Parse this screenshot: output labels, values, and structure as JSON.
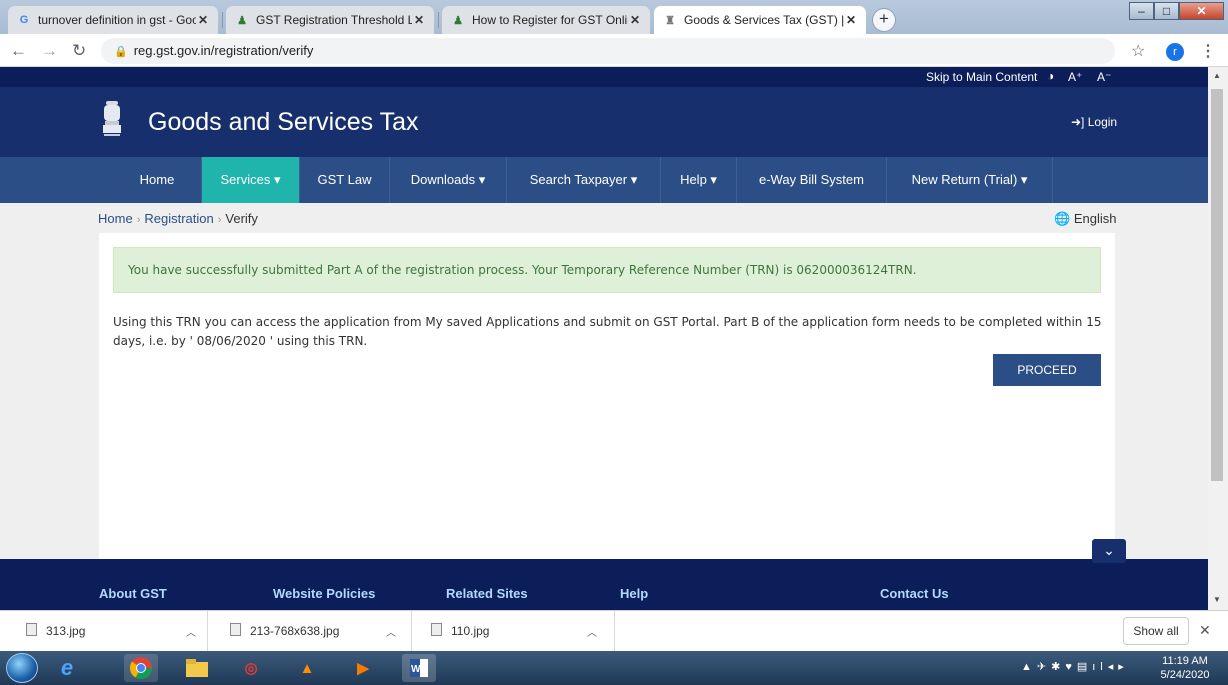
{
  "browser": {
    "tabs": [
      {
        "title": "turnover definition in gst - Goog",
        "icon": "google-icon"
      },
      {
        "title": "GST Registration Threshold Limit",
        "icon": "gst-icon"
      },
      {
        "title": "How to Register for GST Online -",
        "icon": "gst-icon"
      },
      {
        "title": "Goods & Services Tax (GST) | Reg",
        "icon": "emblem-icon"
      }
    ],
    "close_glyph": "✕",
    "new_tab": "+",
    "url": "reg.gst.gov.in/registration/verify",
    "profile_initial": "r"
  },
  "site": {
    "skip_link": "Skip to Main Content",
    "font_increase": "A⁺",
    "font_decrease": "A⁻",
    "title": "Goods and Services Tax",
    "login": "Login",
    "menu": [
      {
        "label": "Home"
      },
      {
        "label": "Services ▾"
      },
      {
        "label": "GST Law"
      },
      {
        "label": "Downloads ▾"
      },
      {
        "label": "Search Taxpayer ▾"
      },
      {
        "label": "Help ▾"
      },
      {
        "label": "e-Way Bill System"
      },
      {
        "label": "New Return (Trial) ▾"
      }
    ],
    "active_menu": "Services",
    "breadcrumb": [
      "Home",
      "Registration",
      "Verify"
    ],
    "language": "English"
  },
  "main": {
    "success_message": "You have successfully submitted Part A of the registration process. Your Temporary Reference Number (TRN) is 062000036124TRN.",
    "info_text": "Using this TRN you can access the application from My saved Applications and submit on GST Portal. Part B of the application form needs to be completed within 15 days, i.e. by ' 08/06/2020 ' using this TRN.",
    "proceed_label": "PROCEED"
  },
  "footer": {
    "links": [
      "About GST",
      "Website Policies",
      "Related Sites",
      "Help",
      "Contact Us"
    ]
  },
  "downloads": {
    "items": [
      "313.jpg",
      "213-768x638.jpg",
      "110.jpg"
    ],
    "show_all": "Show all"
  },
  "taskbar": {
    "time": "11:19 AM",
    "date": "5/24/2020"
  },
  "colors": {
    "header_bg": "#17306d",
    "menu_bg": "#2c4e86",
    "active_menu_bg": "#1fb5ad",
    "success_bg": "#dff0d8",
    "footer_bg": "#0b1e59"
  }
}
